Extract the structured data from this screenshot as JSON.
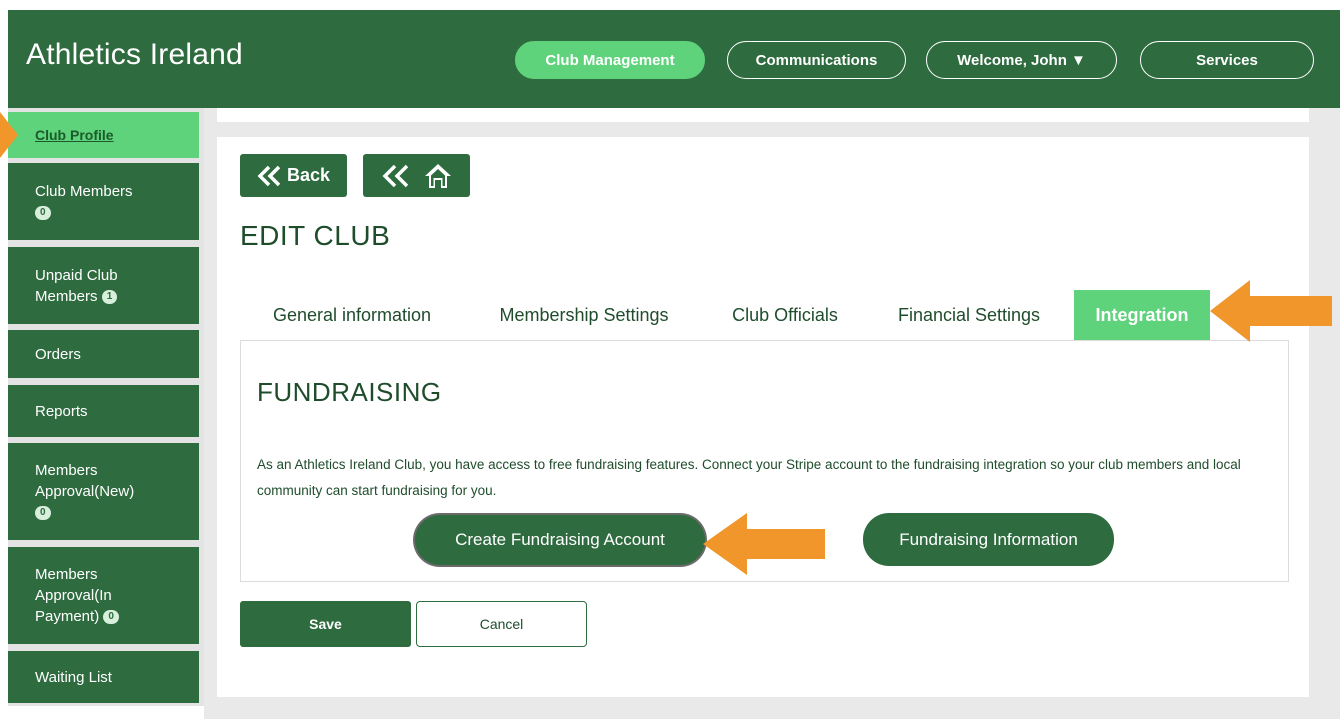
{
  "header": {
    "brand": "Athletics Ireland",
    "nav": {
      "club_management": "Club Management",
      "communications": "Communications",
      "welcome": "Welcome, John ▼",
      "services": "Services"
    }
  },
  "sidebar": {
    "items": [
      {
        "label": "Club Profile"
      },
      {
        "label": "Club Members",
        "badge": "0"
      },
      {
        "label": "Unpaid Club",
        "label2": "Members",
        "badge": "1"
      },
      {
        "label": "Orders"
      },
      {
        "label": "Reports"
      },
      {
        "label": "Members",
        "label2": "Approval(New)",
        "badge": "0"
      },
      {
        "label": "Members",
        "label2": "Approval(In",
        "label3": "Payment)",
        "badge": "0"
      },
      {
        "label": "Waiting List"
      }
    ]
  },
  "main": {
    "back_label": "Back",
    "page_title": "EDIT CLUB",
    "tabs": [
      {
        "label": "General information"
      },
      {
        "label": "Membership Settings"
      },
      {
        "label": "Club Officials"
      },
      {
        "label": "Financial Settings"
      },
      {
        "label": "Integration",
        "active": true
      }
    ],
    "section_title": "FUNDRAISING",
    "description": "As an Athletics Ireland Club, you have access to free fundraising features. Connect your Stripe account to the fundraising integration so your club members and local community can start fundraising for you.",
    "create_fundraising": "Create Fundraising Account",
    "fundraising_info": "Fundraising Information",
    "save": "Save",
    "cancel": "Cancel"
  },
  "colors": {
    "brand_green": "#2e6b3f",
    "accent_green": "#5ed37b",
    "arrow_orange": "#f0962a"
  }
}
